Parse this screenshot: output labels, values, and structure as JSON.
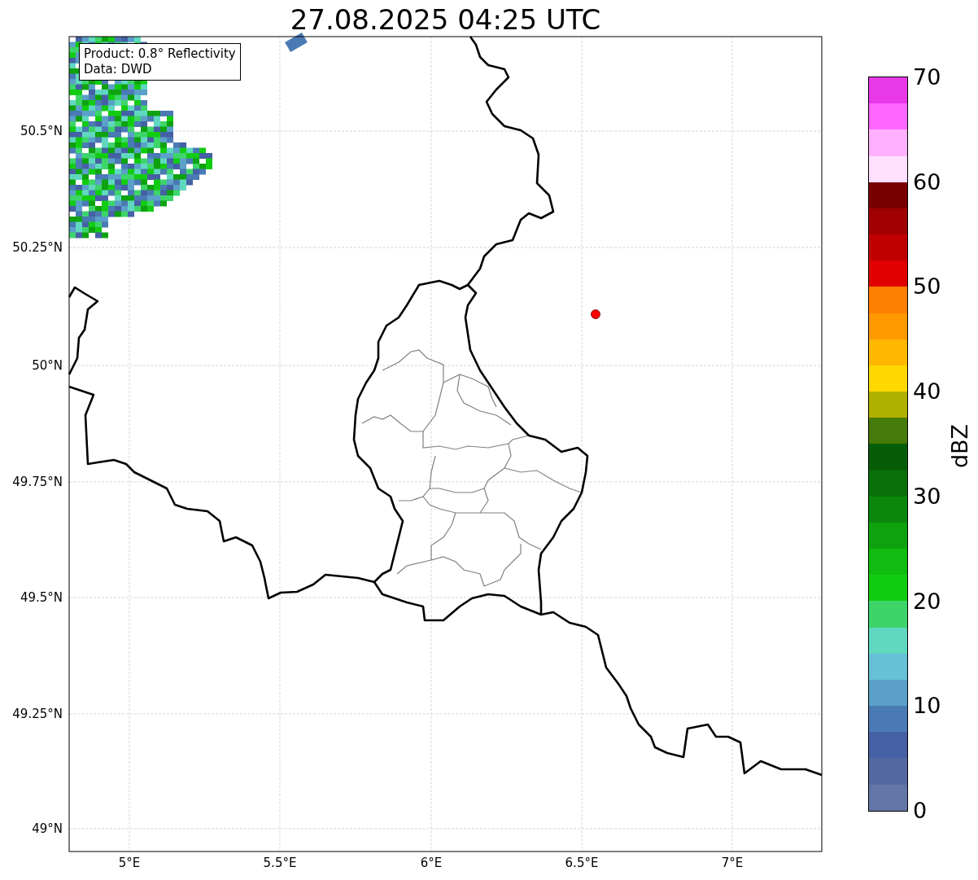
{
  "title": "27.08.2025 04:25 UTC",
  "map": {
    "info_box": [
      "Product: 0.8° Reflectivity",
      "Data: DWD"
    ],
    "lat_labels": [
      "50.5°N",
      "50.25°N",
      "50°N",
      "49.75°N",
      "49.5°N",
      "49.25°N",
      "49°N"
    ],
    "lon_labels": [
      "5°E",
      "5.5°E",
      "6°E",
      "6.5°E",
      "7°E"
    ]
  },
  "colorbar": {
    "label": "dBZ",
    "ticks": [
      "70",
      "60",
      "50",
      "40",
      "30",
      "20",
      "10",
      "0"
    ],
    "bins": [
      {
        "color": "#e838e8"
      },
      {
        "color": "#ff66ff"
      },
      {
        "color": "#ffb0ff"
      },
      {
        "color": "#ffe0ff"
      },
      {
        "color": "#780000"
      },
      {
        "color": "#a00000"
      },
      {
        "color": "#c00000"
      },
      {
        "color": "#e00000"
      },
      {
        "color": "#ff8000"
      },
      {
        "color": "#ff9900"
      },
      {
        "color": "#ffb800"
      },
      {
        "color": "#ffd800"
      },
      {
        "color": "#b0b000"
      },
      {
        "color": "#467a0a"
      },
      {
        "color": "#075d07"
      },
      {
        "color": "#0a700a"
      },
      {
        "color": "#0b880b"
      },
      {
        "color": "#0ea20e"
      },
      {
        "color": "#10bc10"
      },
      {
        "color": "#12cc12"
      },
      {
        "color": "#3dd46a"
      },
      {
        "color": "#60d8c0"
      },
      {
        "color": "#66c0d8"
      },
      {
        "color": "#5aa0c8"
      },
      {
        "color": "#4a7ab4"
      },
      {
        "color": "#4560a4"
      },
      {
        "color": "#5468a0"
      },
      {
        "color": "#6475a8"
      }
    ]
  }
}
